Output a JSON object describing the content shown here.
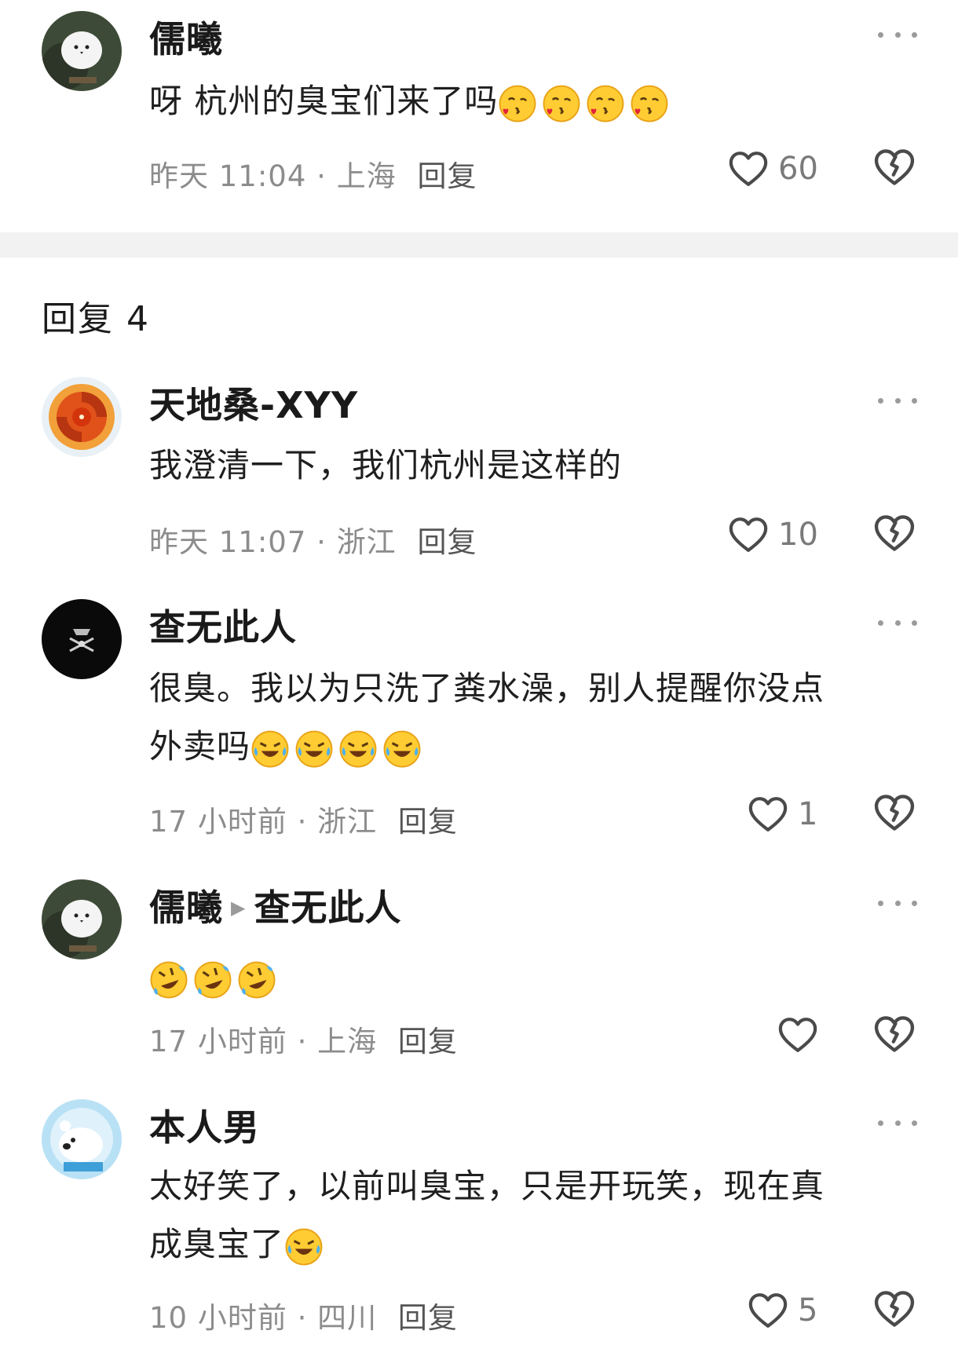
{
  "comments": [
    {
      "name": "儒曦",
      "text": "呀 杭州的臭宝们来了吗",
      "emojis": [
        "kiss-heart-emoji",
        "kiss-heart-emoji",
        "kiss-heart-emoji",
        "kiss-heart-emoji"
      ],
      "time": "昨天 11:04",
      "location": "上海",
      "reply_label": "回复",
      "likes": "60"
    }
  ],
  "replies_header": "回复 4",
  "replies": [
    {
      "name": "天地桑-XYY",
      "text": "我澄清一下，我们杭州是这样的",
      "time": "昨天 11:07",
      "location": "浙江",
      "reply_label": "回复",
      "likes": "10"
    },
    {
      "name": "查无此人",
      "text_line1": "很臭。我以为只洗了粪水澡，别人提醒你没点",
      "text_line2": "外卖吗",
      "emojis": [
        "laugh-cry-emoji",
        "laugh-cry-emoji",
        "laugh-cry-emoji",
        "laugh-cry-emoji"
      ],
      "time": "17 小时前",
      "location": "浙江",
      "reply_label": "回复",
      "likes": "1"
    },
    {
      "name": "儒曦",
      "reply_to": "查无此人",
      "emojis": [
        "rofl-emoji",
        "rofl-emoji",
        "rofl-emoji"
      ],
      "time": "17 小时前",
      "location": "上海",
      "reply_label": "回复",
      "likes": ""
    },
    {
      "name": "本人男",
      "text_line1": "太好笑了，以前叫臭宝，只是开玩笑，现在真",
      "text_line2": "成臭宝了",
      "emojis": [
        "laugh-cry-emoji"
      ],
      "time": "10 小时前",
      "location": "四川",
      "reply_label": "回复",
      "likes": "5"
    }
  ],
  "separator": "·",
  "colors": {
    "text": "#1f1f1f",
    "meta": "#8c8c8c",
    "divider": "#f2f2f2"
  }
}
